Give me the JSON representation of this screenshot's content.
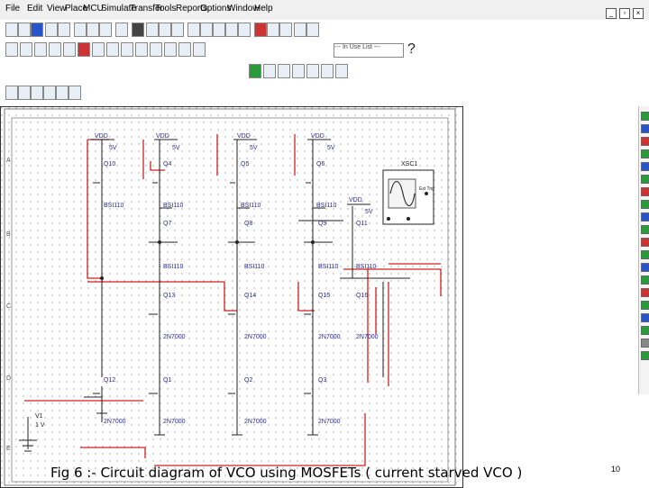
{
  "menubar": {
    "items": [
      "File",
      "Edit",
      "View",
      "Place",
      "MCU",
      "Simulate",
      "Transfer",
      "Tools",
      "Reports",
      "Options",
      "Window",
      "Help"
    ]
  },
  "toolbar": {
    "zoom_value": "--- In Use List ---",
    "help_glyph": "?"
  },
  "schematic": {
    "labels": {
      "vdd1": "VDD",
      "vdd1_v": "5V",
      "vdd2": "VDD",
      "vdd2_v": "5V",
      "vdd3": "VDD",
      "vdd3_v": "5V",
      "vdd4": "VDD",
      "vdd4_v": "5V",
      "vdd5": "VDD",
      "vdd5_v": "5V",
      "q10": "Q10",
      "q4": "Q4",
      "q5": "Q5",
      "q6": "Q6",
      "bs_a": "BSI110",
      "bs_b": "BSI110",
      "bs_c": "BSI110",
      "bs_d": "BSI110",
      "q7": "Q7",
      "q8": "Q8",
      "q9": "Q9",
      "q11": "Q11",
      "bs_e": "BSI110",
      "bs_f": "BSI110",
      "bs_g": "BSI110",
      "bs_h": "BSI110",
      "q13": "Q13",
      "q14": "Q14",
      "q15": "Q15",
      "q16": "Q16",
      "n_a": "2N7000",
      "n_b": "2N7000",
      "n_c": "2N7000",
      "n_d": "2N7000",
      "q12": "Q12",
      "q1": "Q1",
      "q2": "Q2",
      "q3": "Q3",
      "n_e": "2N7000",
      "n_f": "2N7000",
      "n_g": "2N7000",
      "n_h": "2N7000",
      "v1": "V1",
      "v1_val": "1 V",
      "xsc1": "XSC1",
      "ext_trig": "Ext Trig",
      "row_a": "A",
      "row_b": "B",
      "row_c": "C",
      "row_d": "D",
      "row_e": "E"
    }
  },
  "caption": "Fig 6 :- Circuit diagram of VCO using MOSFETs ( current starved VCO )",
  "page_number": "10",
  "colors": {
    "wire_red": "#d02020",
    "wire_black": "#222222",
    "label_blue": "#2a2a9a",
    "grid_dot": "#9a9a9a"
  }
}
